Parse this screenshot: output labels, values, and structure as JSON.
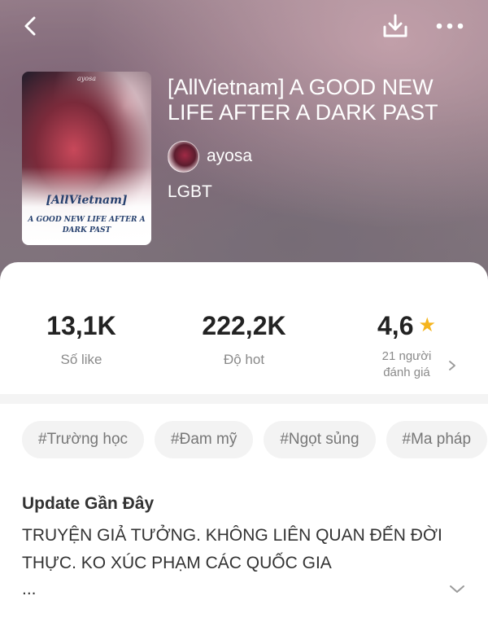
{
  "header": {
    "back_icon": "chevron-left-icon",
    "download_icon": "download-icon",
    "more_icon": "more-horizontal-icon"
  },
  "book": {
    "cover": {
      "author_mark": "ayosa",
      "series": "[AllVietnam]",
      "title": "A GOOD NEW LIFE AFTER A DARK PAST"
    },
    "title": "[AllVietnam] A GOOD NEW LIFE AFTER A DARK PAST",
    "author": "ayosa",
    "genre": "LGBT"
  },
  "stats": {
    "likes": {
      "value": "13,1K",
      "label": "Số like"
    },
    "hot": {
      "value": "222,2K",
      "label": "Độ hot"
    },
    "rating": {
      "value": "4,6",
      "label": "21 người đánh giá",
      "star_color": "#f5b41c"
    }
  },
  "tags": [
    "#Trường học",
    "#Đam mỹ",
    "#Ngọt sủng",
    "#Ma pháp"
  ],
  "update": {
    "title": "Update Gần Đây",
    "text": "TRUYỆN GIẢ TƯỞNG. KHÔNG LIÊN QUAN ĐẾN ĐỜI THỰC. KO XÚC PHẠM CÁC QUỐC GIA",
    "ellipsis": "..."
  }
}
